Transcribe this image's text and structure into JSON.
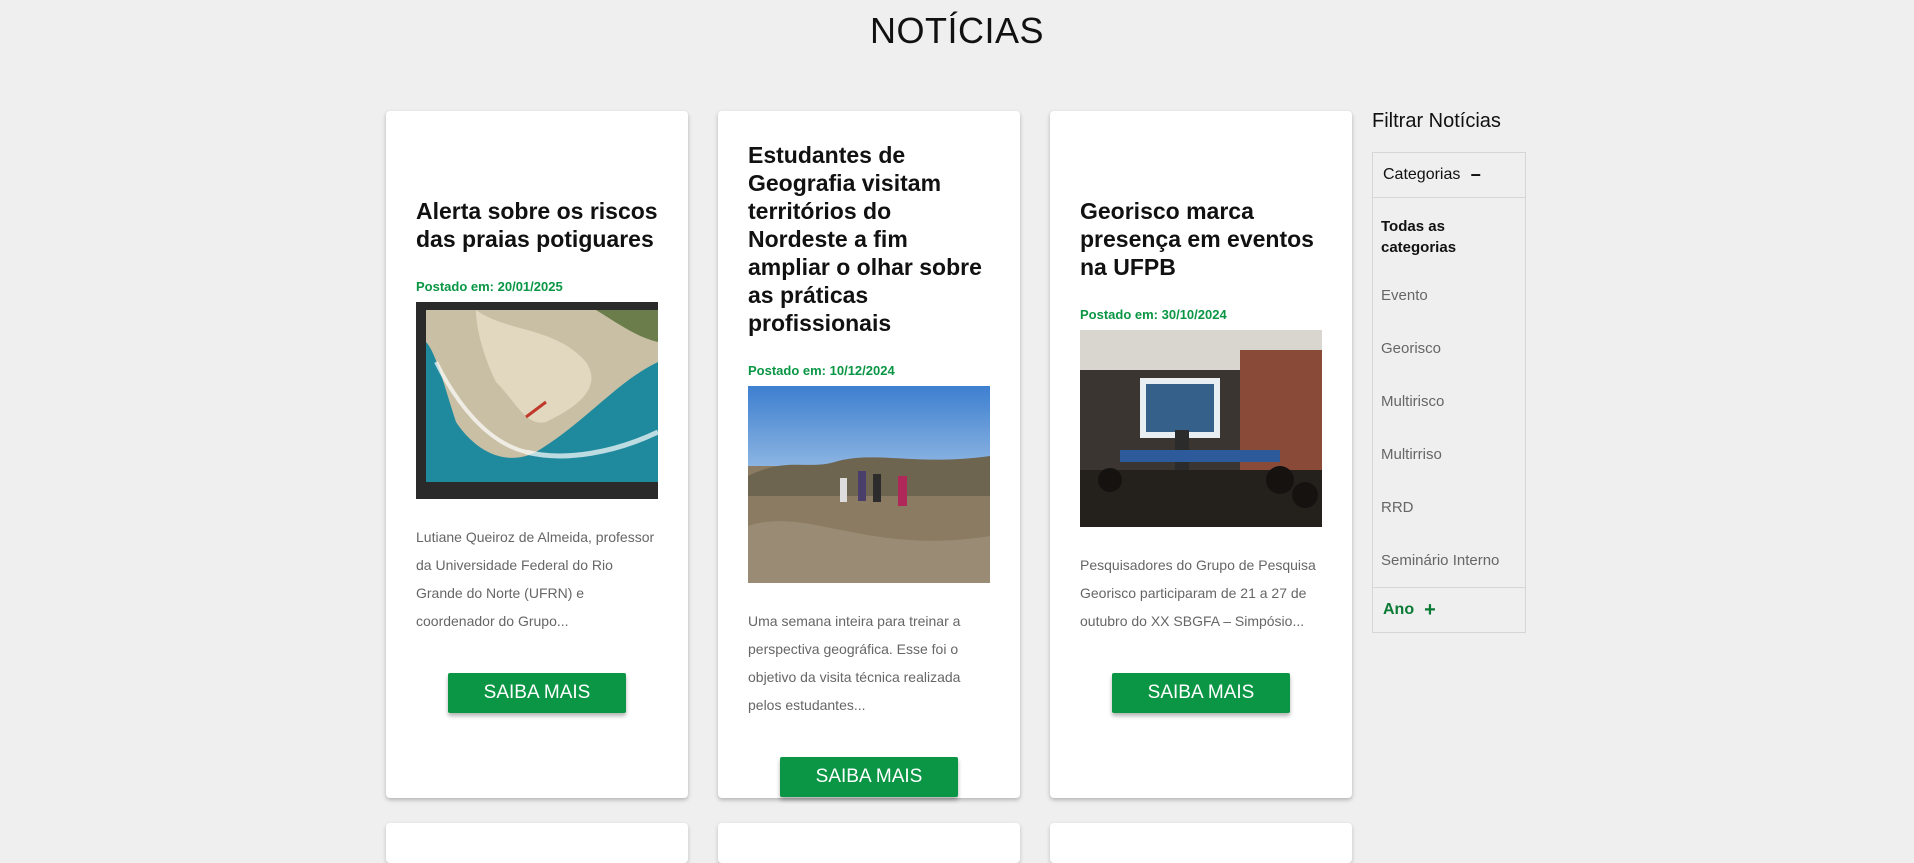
{
  "page": {
    "title": "NOTÍCIAS"
  },
  "news": [
    {
      "title": "Alerta sobre os riscos das praias potiguares",
      "date": "Postado em: 20/01/2025",
      "excerpt": "Lutiane Queiroz de Almeida, professor da Universidade Federal do Rio Grande do Norte (UFRN) e coordenador do Grupo...",
      "button": "SAIBA MAIS"
    },
    {
      "title": "Estudantes de Geografia visitam territórios do Nordeste a fim ampliar o olhar sobre as práticas profissionais",
      "date": "Postado em: 10/12/2024",
      "excerpt": "Uma semana inteira para treinar a perspectiva geográfica. Esse foi o objetivo da visita técnica realizada pelos estudantes...",
      "button": "SAIBA MAIS"
    },
    {
      "title": "Georisco marca presença em eventos na UFPB",
      "date": "Postado em: 30/10/2024",
      "excerpt": "Pesquisadores do Grupo de Pesquisa Georisco participaram de 21 a 27 de outubro do XX SBGFA – Simpósio...",
      "button": "SAIBA MAIS"
    }
  ],
  "filter": {
    "heading": "Filtrar Notícias",
    "categories_label": "Categorias",
    "categories_toggle": "−",
    "categories": [
      "Todas as categorias",
      "Evento",
      "Georisco",
      "Multirisco",
      "Multirriso",
      "RRD",
      "Seminário Interno"
    ],
    "year_label": "Ano",
    "year_toggle": "+"
  },
  "colors": {
    "accent": "#0a9644",
    "background": "#efefef"
  }
}
